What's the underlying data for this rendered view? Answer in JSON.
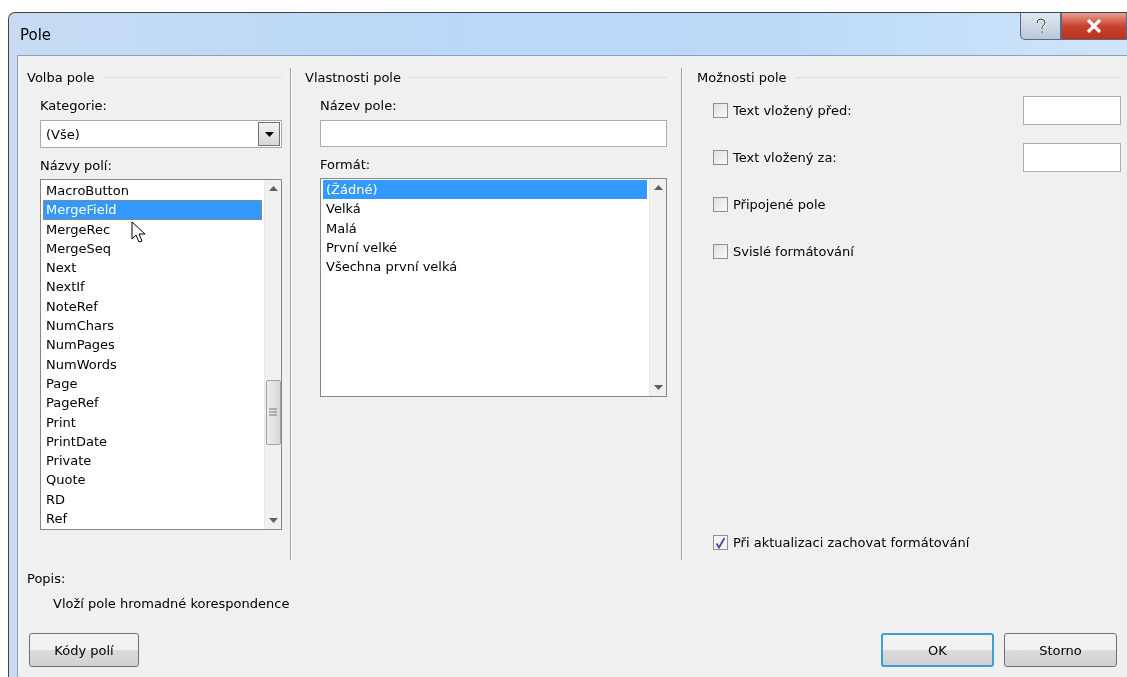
{
  "window": {
    "title": "Pole"
  },
  "field_choice": {
    "heading": "Volba pole",
    "category_label": "Kategorie:",
    "category_value": "(Vše)",
    "names_label": "Názvy polí:",
    "names": [
      {
        "label": "MacroButton",
        "selected": false
      },
      {
        "label": "MergeField",
        "selected": true
      },
      {
        "label": "MergeRec",
        "selected": false
      },
      {
        "label": "MergeSeq",
        "selected": false
      },
      {
        "label": "Next",
        "selected": false
      },
      {
        "label": "NextIf",
        "selected": false
      },
      {
        "label": "NoteRef",
        "selected": false
      },
      {
        "label": "NumChars",
        "selected": false
      },
      {
        "label": "NumPages",
        "selected": false
      },
      {
        "label": "NumWords",
        "selected": false
      },
      {
        "label": "Page",
        "selected": false
      },
      {
        "label": "PageRef",
        "selected": false
      },
      {
        "label": "Print",
        "selected": false
      },
      {
        "label": "PrintDate",
        "selected": false
      },
      {
        "label": "Private",
        "selected": false
      },
      {
        "label": "Quote",
        "selected": false
      },
      {
        "label": "RD",
        "selected": false
      },
      {
        "label": "Ref",
        "selected": false
      }
    ]
  },
  "field_properties": {
    "heading": "Vlastnosti pole",
    "name_label": "Název pole:",
    "format_label": "Formát:",
    "formats": [
      {
        "label": "(Žádné)",
        "selected": true
      },
      {
        "label": "Velká",
        "selected": false
      },
      {
        "label": "Malá",
        "selected": false
      },
      {
        "label": "První velké",
        "selected": false
      },
      {
        "label": "Všechna první velká",
        "selected": false
      }
    ]
  },
  "field_options": {
    "heading": "Možnosti pole",
    "options": [
      {
        "label": "Text vložený před:",
        "checked": false,
        "kind": "with_input"
      },
      {
        "label": "Text vložený za:",
        "checked": false,
        "kind": "with_input"
      },
      {
        "label": "Připojené pole",
        "checked": false,
        "kind": "plain"
      },
      {
        "label": "Svislé formátování",
        "checked": false,
        "kind": "plain"
      }
    ],
    "preserve": {
      "label": "Při aktualizaci zachovat formátování",
      "checked": true
    }
  },
  "description": {
    "label": "Popis:",
    "text": "Vloží pole hromadné korespondence"
  },
  "buttons": [
    {
      "label": "Kódy polí",
      "default": false
    },
    {
      "label": "OK",
      "default": true
    },
    {
      "label": "Storno",
      "default": false
    }
  ]
}
